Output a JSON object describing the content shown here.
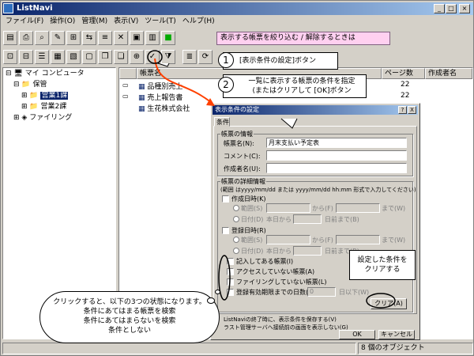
{
  "window": {
    "title": "ListNavi"
  },
  "menu": [
    "ファイル(F)",
    "操作(O)",
    "管理(M)",
    "表示(V)",
    "ツール(T)",
    "ヘルプ(H)"
  ],
  "tree": {
    "root": "マイ コンピュータ",
    "folder": "保管",
    "items": [
      "営業1課",
      "営業2課"
    ],
    "filing": "ファイリング"
  },
  "list": {
    "columns": [
      "帳票名",
      "ページ数",
      "作成者名"
    ],
    "rows": [
      {
        "name": "品種別売上",
        "pages": "22"
      },
      {
        "name": "売上報告書",
        "pages": "22"
      },
      {
        "name": "生花株式会社",
        "pages": ""
      }
    ]
  },
  "status": {
    "count": "8 個のオブジェクト"
  },
  "dialog": {
    "title": "表示条件の設定",
    "help_btn": "?",
    "close_btn": "X",
    "tab": "条件",
    "group1": "帳票の情報",
    "form_name_label": "帳票名(N):",
    "form_name_value": "月末支払い予定表",
    "comment_label": "コメント(C):",
    "author_label": "作成者名(U):",
    "group2": "帳票の詳細情報",
    "range_note": "(範囲 はyyyy/mm/dd または yyyy/mm/dd hh:mm 形式で入力してください)",
    "created_label": "作成日時(K)",
    "range_label": "範囲(S)",
    "from_label": "から(F)",
    "to_label": "まで(W)",
    "day_label": "日付(D)",
    "today_label": "本日から",
    "days_before": "日前まで(B)",
    "registered_label": "登録日時(R)",
    "cb1": "記入してある帳票(I)",
    "cb2": "アクセスしていない帳票(A)",
    "cb3": "ファイリングしていない帳票(L)",
    "cb4": "登録有効期限までの日数(E)",
    "days_value": "0",
    "days_after": "日以下(W)",
    "clear_btn": "クリア(A)",
    "save_note": "ListNaviの終了時に、表示条件を保存する(V)",
    "server_note": "ラスト管理サーバへ接続前の画面を表示しない(G)",
    "ok_btn": "OK",
    "cancel_btn": "キャンセル"
  },
  "annotations": {
    "header": "表示する帳票を絞り込む / 解除するときは",
    "step1_num": "1",
    "step1": "[表示条件の設定]ボタン",
    "step2_num": "2",
    "step2_line1": "一覧に表示する帳票の条件を指定",
    "step2_line2": "(またはクリアして [OK]ボタン",
    "clear_note_line1": "設定した条件を",
    "clear_note_line2": "クリアする",
    "cloud_line1": "クリックすると、以下の3つの状態になります。",
    "cloud_line2": "条件にあてはまる帳票を検索",
    "cloud_line3": "条件にあてはまらないを検索",
    "cloud_line4": "条件としない"
  },
  "colors": {
    "title_start": "#0a246a",
    "title_end": "#a6caf0",
    "header_callout": "#ffd0f0",
    "arrow": "#ff4000"
  }
}
